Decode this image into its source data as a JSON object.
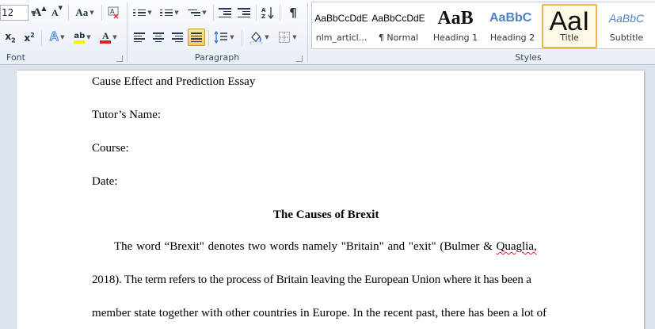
{
  "ribbon": {
    "font_group": {
      "label": "Font",
      "font_size": "12",
      "grow_font": "A",
      "shrink_font": "A",
      "change_case": "Aa",
      "subscript": "x",
      "subscript_mark": "2",
      "superscript": "x",
      "superscript_mark": "2",
      "highlight_label": "ab",
      "font_color_label": "A",
      "highlight_color": "#f5f500",
      "font_color": "#e02020"
    },
    "paragraph_group": {
      "label": "Paragraph",
      "pilcrow": "¶"
    },
    "styles_group": {
      "label": "Styles",
      "items": [
        {
          "sample": "AaBbCcDdE",
          "name": "nlm_articl..."
        },
        {
          "sample": "AaBbCcDdE",
          "name": "¶ Normal"
        },
        {
          "sample": "AaB",
          "name": "Heading 1"
        },
        {
          "sample": "AaBbC",
          "name": "Heading 2"
        },
        {
          "sample": "AaI",
          "name": "Title"
        },
        {
          "sample": "AaBbC",
          "name": "Subtitle"
        }
      ],
      "selected": "Title"
    }
  },
  "document": {
    "title": "Cause Effect and Prediction Essay",
    "tutor": "Tutor’s Name:",
    "course": "Course:",
    "date": "Date:",
    "heading": "The Causes of Brexit",
    "para_line1_before": "The word “Brexit\" denotes two words namely  \"Britain\" and \"exit\" (Bulmer  & ",
    "para_line1_misspelled": "Quaglia,",
    "para_line2": "2018). The term refers to the process of Britain leaving the European Union where it has been a",
    "para_line3": "member state together with other countries in Europe. In the recent past, there has been a lot of"
  }
}
